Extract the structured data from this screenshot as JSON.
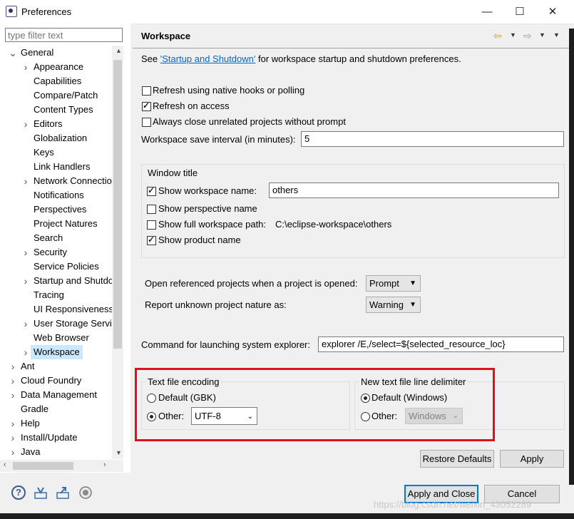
{
  "window": {
    "title": "Preferences",
    "minimize": "—",
    "maximize": "☐",
    "close": "✕"
  },
  "filter": {
    "placeholder": "type filter text"
  },
  "tree": [
    {
      "label": "General",
      "level": 0,
      "twisty": "open"
    },
    {
      "label": "Appearance",
      "level": 1,
      "twisty": "closed"
    },
    {
      "label": "Capabilities",
      "level": 1,
      "twisty": ""
    },
    {
      "label": "Compare/Patch",
      "level": 1,
      "twisty": ""
    },
    {
      "label": "Content Types",
      "level": 1,
      "twisty": ""
    },
    {
      "label": "Editors",
      "level": 1,
      "twisty": "closed"
    },
    {
      "label": "Globalization",
      "level": 1,
      "twisty": ""
    },
    {
      "label": "Keys",
      "level": 1,
      "twisty": ""
    },
    {
      "label": "Link Handlers",
      "level": 1,
      "twisty": ""
    },
    {
      "label": "Network Connectio",
      "level": 1,
      "twisty": "closed"
    },
    {
      "label": "Notifications",
      "level": 1,
      "twisty": ""
    },
    {
      "label": "Perspectives",
      "level": 1,
      "twisty": ""
    },
    {
      "label": "Project Natures",
      "level": 1,
      "twisty": ""
    },
    {
      "label": "Search",
      "level": 1,
      "twisty": ""
    },
    {
      "label": "Security",
      "level": 1,
      "twisty": "closed"
    },
    {
      "label": "Service Policies",
      "level": 1,
      "twisty": ""
    },
    {
      "label": "Startup and Shutdo",
      "level": 1,
      "twisty": "closed"
    },
    {
      "label": "Tracing",
      "level": 1,
      "twisty": ""
    },
    {
      "label": "UI Responsiveness",
      "level": 1,
      "twisty": ""
    },
    {
      "label": "User Storage Servic",
      "level": 1,
      "twisty": "closed"
    },
    {
      "label": "Web Browser",
      "level": 1,
      "twisty": ""
    },
    {
      "label": "Workspace",
      "level": 1,
      "twisty": "closed",
      "selected": true
    },
    {
      "label": "Ant",
      "level": 0,
      "twisty": "closed"
    },
    {
      "label": "Cloud Foundry",
      "level": 0,
      "twisty": "closed"
    },
    {
      "label": "Data Management",
      "level": 0,
      "twisty": "closed"
    },
    {
      "label": "Gradle",
      "level": 0,
      "twisty": ""
    },
    {
      "label": "Help",
      "level": 0,
      "twisty": "closed"
    },
    {
      "label": "Install/Update",
      "level": 0,
      "twisty": "closed"
    },
    {
      "label": "Java",
      "level": 0,
      "twisty": "closed"
    }
  ],
  "page": {
    "title": "Workspace",
    "see_prefix": "See ",
    "see_link": "'Startup and Shutdown'",
    "see_suffix": " for workspace startup and shutdown preferences.",
    "refresh_native": "Refresh using native hooks or polling",
    "refresh_access": "Refresh on access",
    "always_close": "Always close unrelated projects without prompt",
    "save_interval_label": "Workspace save interval (in minutes):",
    "save_interval_value": "5",
    "window_title_group": "Window title",
    "show_ws_name": "Show workspace name:",
    "ws_name_value": "others",
    "show_perspective": "Show perspective name",
    "show_full_path": "Show full workspace path:",
    "full_path_value": "C:\\eclipse-workspace\\others",
    "show_product": "Show product name",
    "open_ref_label": "Open referenced projects when a project is opened:",
    "open_ref_value": "Prompt",
    "report_nature_label": "Report unknown project nature as:",
    "report_nature_value": "Warning",
    "cmd_label": "Command for launching system explorer:",
    "cmd_value": "explorer /E,/select=${selected_resource_loc}",
    "encoding_group": "Text file encoding",
    "enc_default": "Default (GBK)",
    "enc_other": "Other:",
    "enc_other_value": "UTF-8",
    "delim_group": "New text file line delimiter",
    "delim_default": "Default (Windows)",
    "delim_other": "Other:",
    "delim_other_value": "Windows"
  },
  "buttons": {
    "restore": "Restore Defaults",
    "apply": "Apply",
    "apply_close": "Apply and Close",
    "cancel": "Cancel"
  },
  "watermark": "https://blog.csdn.net/weixin_43052289",
  "colors": {
    "highlight": "#e0101a",
    "selection": "#cce8ff",
    "link": "#0066cc",
    "default_button": "#0078d7"
  }
}
